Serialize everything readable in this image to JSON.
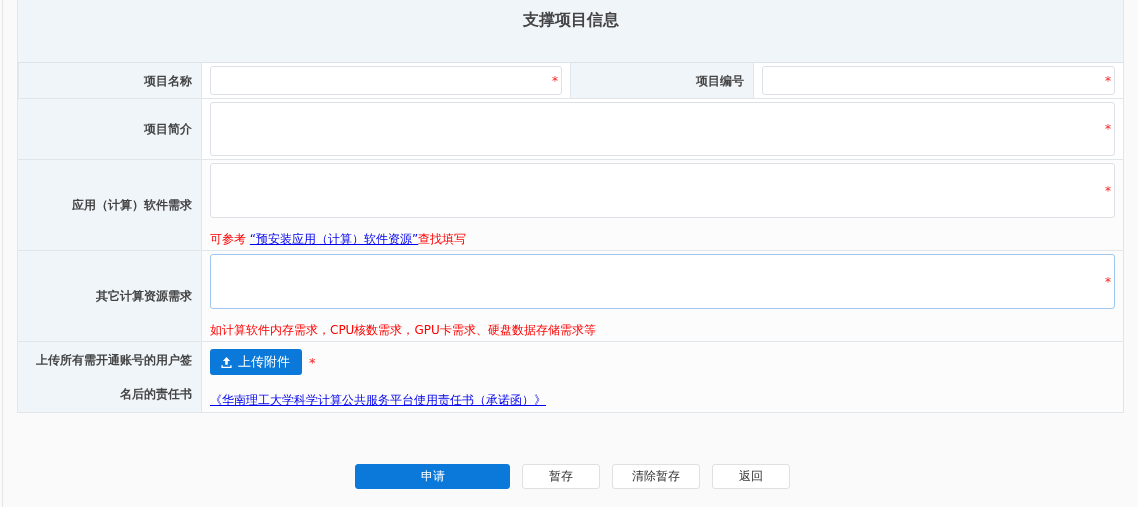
{
  "form": {
    "title": "支撑项目信息",
    "rows": [
      {
        "kind": "pair",
        "fields": [
          {
            "label": "项目名称",
            "required_mark": "*",
            "focused": false
          },
          {
            "label": "项目编号",
            "required_mark": "*",
            "focused": false
          }
        ]
      },
      {
        "kind": "textarea",
        "label": "项目简介",
        "required_mark": "*",
        "focused": false
      },
      {
        "kind": "textarea",
        "label": "应用（计算）软件需求",
        "required_mark": "*",
        "focused": false,
        "hint": {
          "before": "可参考 ",
          "link": "“预安装应用（计算）软件资源”",
          "after": "查找填写"
        }
      },
      {
        "kind": "textarea",
        "label": "其它计算资源需求",
        "required_mark": "*",
        "focused": true,
        "hint": {
          "before": "如计算软件内存需求，CPU核数需求，GPU卡需求、硬盘数据存储需求等"
        }
      },
      {
        "kind": "upload",
        "label": "上传所有需开通账号的用户签名后的责任书",
        "button": "上传附件",
        "required_mark": "*",
        "link": "《华南理工大学科学计算公共服务平台使用责任书（承诺函）》"
      }
    ]
  },
  "buttons": [
    {
      "label": "申请",
      "kind": "primary"
    },
    {
      "label": "暂存",
      "kind": "plain"
    },
    {
      "label": "清除暂存",
      "kind": "plain"
    },
    {
      "label": "返回",
      "kind": "plain"
    }
  ]
}
